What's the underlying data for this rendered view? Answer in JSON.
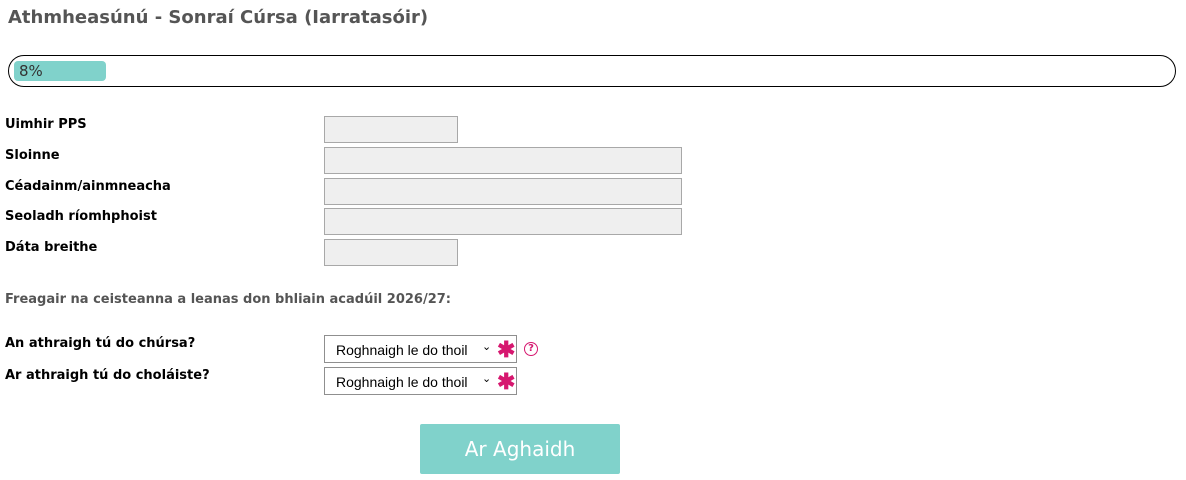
{
  "header": {
    "title": "Athmheasúnú - Sonraí Cúrsa (Iarratasóir)"
  },
  "progress": {
    "label": "8%",
    "value": 8
  },
  "fields": {
    "pps": {
      "label": "Uimhir PPS",
      "value": ""
    },
    "surname": {
      "label": "Sloinne",
      "value": ""
    },
    "forenames": {
      "label": "Céadainm/ainmneacha",
      "value": ""
    },
    "email": {
      "label": "Seoladh ríomhphoist",
      "value": ""
    },
    "dob": {
      "label": "Dáta breithe",
      "value": ""
    }
  },
  "questions": {
    "intro": "Freagair na ceisteanna a leanas don bhliain acadúil 2026/27:",
    "course_change": {
      "label": "An athraigh tú do chúrsa?",
      "selected": "Roghnaigh le do thoil",
      "required": "✱",
      "help": "?"
    },
    "college_change": {
      "label": "Ar athraigh tú do choláiste?",
      "selected": "Roghnaigh le do thoil",
      "required": "✱"
    }
  },
  "actions": {
    "next_label": "Ar Aghaidh"
  },
  "colors": {
    "accent": "#80d2cb",
    "required": "#d6176f",
    "title": "#555555"
  },
  "icons": {
    "chevron": "chevron-down-icon",
    "required": "asterisk-icon",
    "help": "help-circle-icon"
  }
}
